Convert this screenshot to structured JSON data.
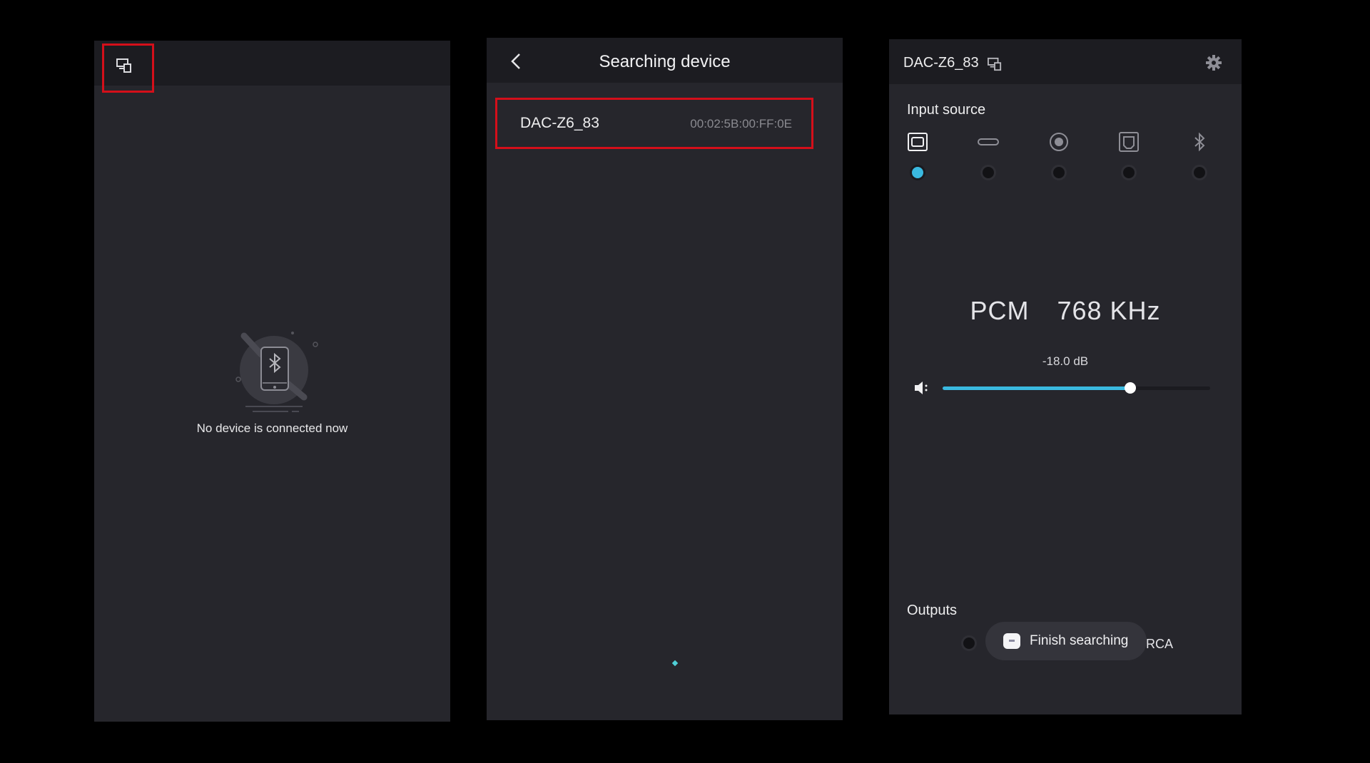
{
  "screens": {
    "empty": {
      "message": "No device is connected now"
    },
    "search": {
      "title": "Searching device",
      "device": {
        "name": "DAC-Z6_83",
        "mac": "00:02:5B:00:FF:0E"
      }
    },
    "control": {
      "device_name": "DAC-Z6_83",
      "input_source_label": "Input source",
      "input_sources": [
        {
          "icon": "coaxial-input-icon",
          "selected": true
        },
        {
          "icon": "usb-c-input-icon",
          "selected": false
        },
        {
          "icon": "optical-input-icon",
          "selected": false
        },
        {
          "icon": "usb-b-input-icon",
          "selected": false
        },
        {
          "icon": "bluetooth-input-icon",
          "selected": false
        }
      ],
      "format": "PCM",
      "sample_rate": "768 KHz",
      "volume_label": "-18.0 dB",
      "volume_fraction": 0.7,
      "outputs_label": "Outputs",
      "output_rca_label": "RCA",
      "toast_text": "Finish searching"
    }
  },
  "colors": {
    "accent": "#3ab9e0",
    "highlight": "#d40f1a",
    "background": "#26262c",
    "appbar": "#1c1c21"
  }
}
